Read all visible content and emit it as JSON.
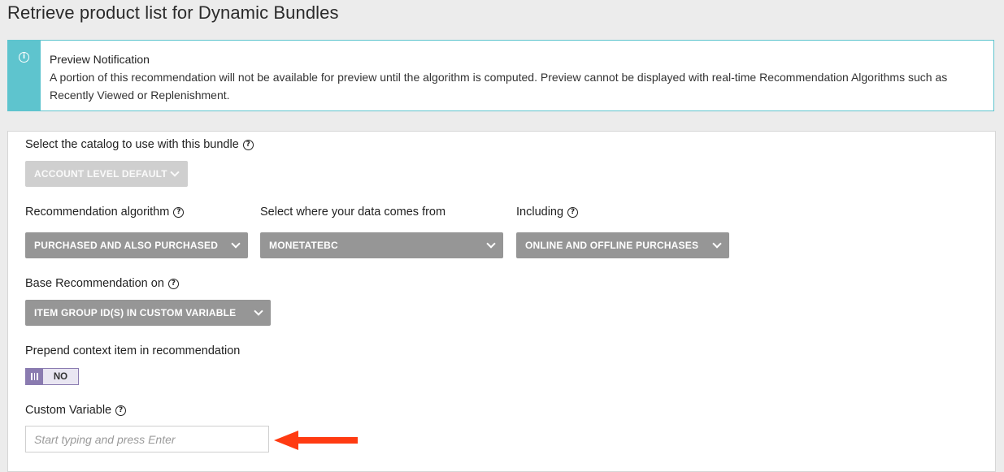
{
  "page": {
    "title": "Retrieve product list for Dynamic Bundles"
  },
  "notification": {
    "icon": "info-icon",
    "title": "Preview Notification",
    "message": "A portion of this recommendation will not be available for preview until the algorithm is computed. Preview cannot be displayed with real-time Recommendation Algorithms such as Recently Viewed or Replenishment.",
    "accent_color": "#5ec4ce"
  },
  "form": {
    "catalog": {
      "label": "Select the catalog to use with this bundle",
      "value": "ACCOUNT LEVEL DEFAULT",
      "disabled": true
    },
    "algorithm": {
      "label": "Recommendation algorithm",
      "value": "PURCHASED AND ALSO PURCHASED"
    },
    "data_source": {
      "label": "Select where your data comes from",
      "value": "MONETATEBC"
    },
    "including": {
      "label": "Including",
      "value": "ONLINE AND OFFLINE PURCHASES"
    },
    "base_recommendation": {
      "label": "Base Recommendation on",
      "value": "ITEM GROUP ID(S) IN CUSTOM VARIABLE"
    },
    "prepend": {
      "label": "Prepend context item in recommendation",
      "toggle_text": "NO",
      "toggle_color": "#8a7bb0"
    },
    "custom_variable": {
      "label": "Custom Variable",
      "placeholder": "Start typing and press Enter",
      "value": ""
    }
  },
  "annotation": {
    "arrow_color": "#ff3b12"
  }
}
